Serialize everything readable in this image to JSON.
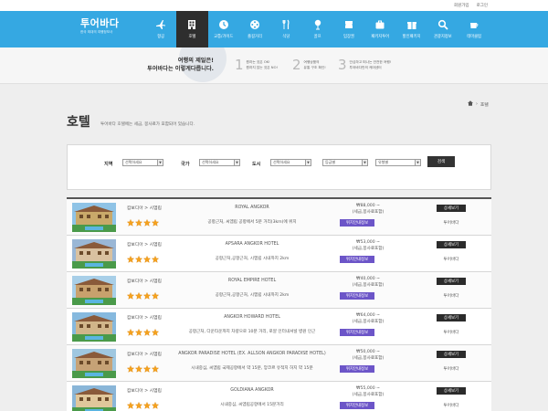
{
  "util": {
    "register": "회원가입",
    "login": "로그인"
  },
  "logo": {
    "title": "투어바다",
    "subtitle": "한국 최대의 여행정보사"
  },
  "nav": [
    {
      "label": "항공",
      "icon": "airplane-icon"
    },
    {
      "label": "호텔",
      "icon": "hotel-icon"
    },
    {
      "label": "교통/가이드",
      "icon": "clock-icon"
    },
    {
      "label": "즐길거리",
      "icon": "film-reel-icon"
    },
    {
      "label": "식당",
      "icon": "dining-icon"
    },
    {
      "label": "골프",
      "icon": "golf-icon"
    },
    {
      "label": "입장권",
      "icon": "ticket-icon"
    },
    {
      "label": "패키지투어",
      "icon": "luggage-icon"
    },
    {
      "label": "할인패키지",
      "icon": "gift-icon"
    },
    {
      "label": "관광지정보",
      "icon": "search-icon"
    },
    {
      "label": "테마클럽",
      "icon": "coffee-icon"
    }
  ],
  "promo": {
    "line1": "여행의 제일은!",
    "line2": "투어바다는 이렇게다릅니다.",
    "steps": [
      {
        "num": "1",
        "l1": "원하는 것은 OK!",
        "l2": "원하지 않는 것은 NO!"
      },
      {
        "num": "2",
        "l1": "여행상품의",
        "l2": "유통 구조 확인!"
      },
      {
        "num": "3",
        "l1": "안심하고 떠나는 안전한 여행!",
        "l2": "투어바다만의 케어센터"
      }
    ]
  },
  "breadcrumb": {
    "current": "호텔"
  },
  "page": {
    "title": "호텔",
    "desc": "투어바다 호텔에는 세금, 봉사료가 포함되어 있습니다."
  },
  "search": {
    "region_label": "지역",
    "region_value": "선택하세요",
    "country_label": "국가",
    "country_value": "선택하세요",
    "city_label": "도시",
    "city_value": "선택하세요",
    "grade_value": "등급별",
    "type_value": "유형별",
    "button": "검색"
  },
  "common": {
    "map": "위치안내정보",
    "detail": "상세보기",
    "agent": "투어바다"
  },
  "hotels": [
    {
      "location": "캄보디아 > 시엠립",
      "name": "ROYAL ANGKOR",
      "desc": "공항근처, 씨엠립 공항에서 5분 거리(3km)에 위치",
      "price1": "₩88,000 ~",
      "price2": "(세금,봉사료포함)",
      "stars": 4
    },
    {
      "location": "캄보디아 > 시엠립",
      "name": "APSARA ANGKOR HOTEL",
      "desc": "공항근처,공항근처, 시엠립 시내까지 2km",
      "price1": "₩53,000 ~",
      "price2": "(세금,봉사료포함)",
      "stars": 4
    },
    {
      "location": "캄보디아 > 시엠립",
      "name": "ROYAL EMPIRE HOTEL",
      "desc": "공항근처,공항근처, 시엠립 시내까지 2km",
      "price1": "₩40,000 ~",
      "price2": "(세금,봉사료포함)",
      "stars": 4
    },
    {
      "location": "캄보디아 > 시엠립",
      "name": "ANGKOR HOWARD HOTEL",
      "desc": "공항근처, 다운타운까지 차량으로 10분 거리, 로얄 인터내셔널 병원 인근",
      "price1": "₩64,000 ~",
      "price2": "(세금,봉사료포함)",
      "stars": 4
    },
    {
      "location": "캄보디아 > 시엠립",
      "name": "ANGKOR PARADISE HOTEL (EX. ALLSON ANGKOR PARADISE HOTEL)",
      "desc": "시내중심, 씨엠립 국제공항에서 약 15분, 앙코르 유적지 허지 약 15분",
      "price1": "₩50,000 ~",
      "price2": "(세금,봉사료포함)",
      "stars": 4
    },
    {
      "location": "캄보디아 > 시엠립",
      "name": "GOLDIANA ANGKOR",
      "desc": "시내중심, 씨엠립공항에서 15분거리",
      "price1": "₩55,000 ~",
      "price2": "(세금,봉사료포함)",
      "stars": 4
    }
  ]
}
